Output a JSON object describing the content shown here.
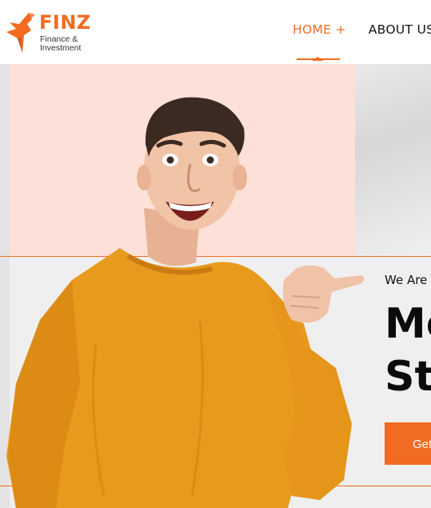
{
  "brand": {
    "name": "FINZ",
    "tagline": "Finance & Investment",
    "color": "#f26b22"
  },
  "nav": {
    "items": [
      {
        "label": "HOME +",
        "active": true
      },
      {
        "label": "ABOUT US",
        "active": false
      }
    ]
  },
  "hero": {
    "eyebrow": "We Are",
    "title_lines": [
      "Mo",
      "St"
    ],
    "cta_label": "Get",
    "image_desc_icon": "person-pointing-thumb"
  },
  "colors": {
    "accent": "#f26b22",
    "peach": "#fde1d8",
    "sweater": "#e89a1c"
  }
}
